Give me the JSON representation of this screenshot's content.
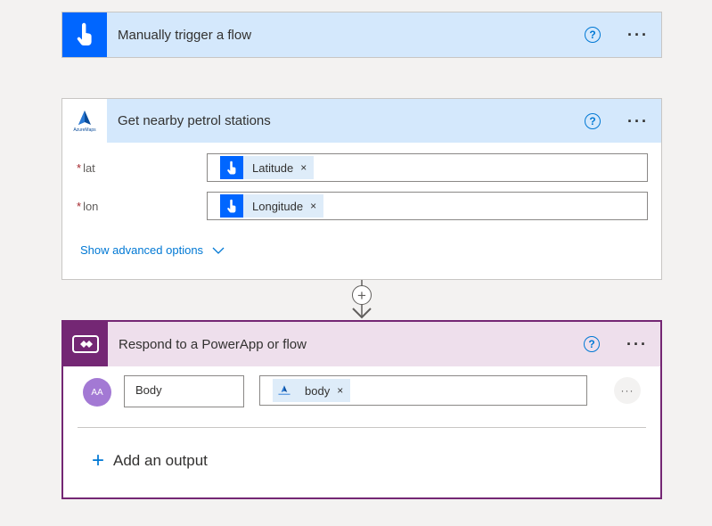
{
  "trigger": {
    "title": "Manually trigger a flow",
    "help": "?",
    "more": "···"
  },
  "maps_action": {
    "title": "Get nearby petrol stations",
    "help": "?",
    "more": "···",
    "fields": [
      {
        "required": "*",
        "label": "lat",
        "token": "Latitude",
        "remove": "×"
      },
      {
        "required": "*",
        "label": "lon",
        "token": "Longitude",
        "remove": "×"
      }
    ],
    "advanced": "Show advanced options",
    "chevron": "∨"
  },
  "insert": {
    "plus": "+"
  },
  "respond": {
    "title": "Respond to a PowerApp or flow",
    "help": "?",
    "more": "···",
    "output": {
      "avatar": "AA",
      "name_value": "Body",
      "token": "body",
      "remove": "×",
      "row_more": "···"
    },
    "add_output": "Add an output",
    "add_plus": "+"
  },
  "colors": {
    "trigger_header": "#d4e8fc",
    "trigger_tile": "#0066ff",
    "maps_header": "#d4e8fc",
    "respond_header": "#eedfec",
    "respond_tile": "#742774",
    "respond_border": "#742774",
    "accent": "#0078d4"
  },
  "icons": {
    "trigger": "hand-tap-icon",
    "maps": "azure-maps-icon",
    "respond": "powerapps-icon",
    "help": "question-circle-icon",
    "more": "ellipsis-icon"
  }
}
